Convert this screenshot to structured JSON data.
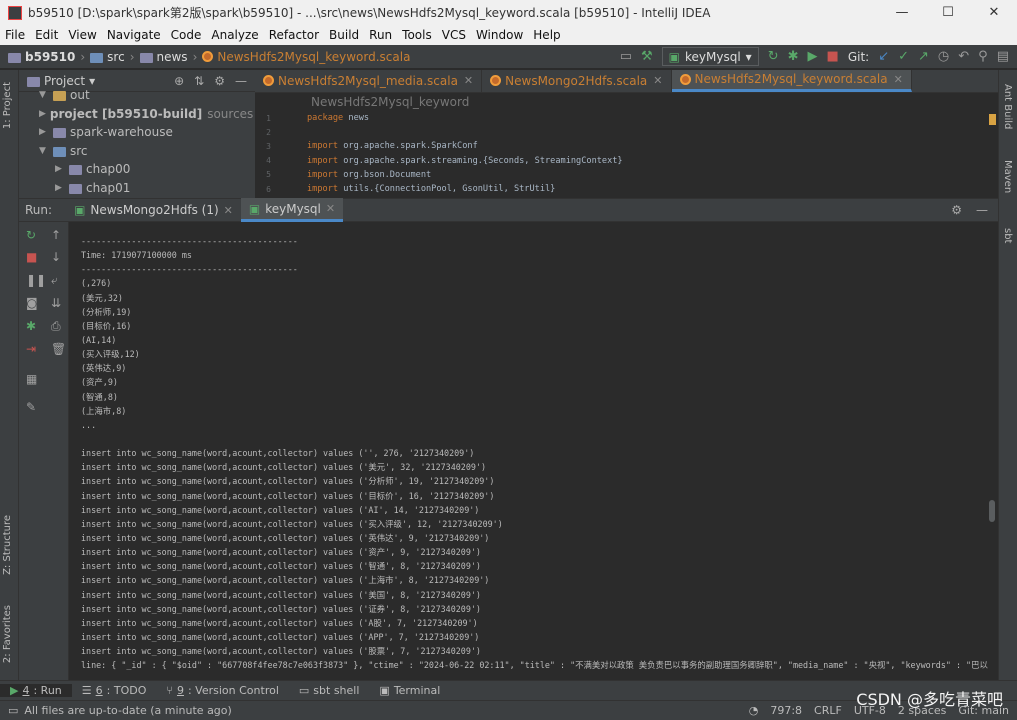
{
  "window": {
    "title": "b59510 [D:\\spark\\spark第2版\\spark\\b59510] - ...\\src\\news\\NewsHdfs2Mysql_keyword.scala [b59510] - IntelliJ IDEA",
    "controls": [
      "—",
      "☐",
      "✕"
    ]
  },
  "menu": [
    "File",
    "Edit",
    "View",
    "Navigate",
    "Code",
    "Analyze",
    "Refactor",
    "Build",
    "Run",
    "Tools",
    "VCS",
    "Window",
    "Help"
  ],
  "breadcrumb": {
    "project": "b59510",
    "src": "src",
    "pkg": "news",
    "file": "NewsHdfs2Mysql_keyword.scala"
  },
  "toolbar": {
    "run_config": "keyMysql",
    "git_label": "Git:"
  },
  "left_strip": {
    "project_tab": "1: Project",
    "structure_tab": "Z: Structure",
    "favorites_tab": "2: Favorites"
  },
  "right_strip": {
    "ant": "Ant Build",
    "maven": "Maven",
    "sbt": "sbt"
  },
  "project_panel": {
    "title": "Project",
    "items": [
      {
        "label": "out",
        "indent": 1,
        "expanded": true
      },
      {
        "label": "project [b59510-build]",
        "extra": "sources roo",
        "indent": 1,
        "expanded": false
      },
      {
        "label": "spark-warehouse",
        "indent": 1,
        "expanded": false
      },
      {
        "label": "src",
        "indent": 1,
        "expanded": true
      },
      {
        "label": "chap00",
        "indent": 2,
        "expanded": false
      },
      {
        "label": "chap01",
        "indent": 2,
        "expanded": false
      }
    ]
  },
  "editor": {
    "tabs": [
      {
        "label": "NewsHdfs2Mysql_media.scala",
        "active": false
      },
      {
        "label": "NewsMongo2Hdfs.scala",
        "active": false
      },
      {
        "label": "NewsHdfs2Mysql_keyword.scala",
        "active": true
      }
    ],
    "file_header": "NewsHdfs2Mysql_keyword",
    "lines": [
      {
        "n": "1",
        "kw": "package",
        "rest": " news"
      },
      {
        "n": "2",
        "kw": "",
        "rest": ""
      },
      {
        "n": "3",
        "kw": "import",
        "rest": " org.apache.spark.SparkConf"
      },
      {
        "n": "4",
        "kw": "import",
        "rest": " org.apache.spark.streaming.{Seconds, StreamingContext}"
      },
      {
        "n": "5",
        "kw": "import",
        "rest": " org.bson.Document"
      },
      {
        "n": "6",
        "kw": "import",
        "rest": " utils.{ConnectionPool, GsonUtil, StrUtil}"
      }
    ]
  },
  "run_panel": {
    "label": "Run:",
    "tabs": [
      {
        "label": "NewsMongo2Hdfs (1)",
        "active": false
      },
      {
        "label": "keyMysql",
        "active": true
      }
    ]
  },
  "console": [
    "-------------------------------------------",
    "Time: 1719077100000 ms",
    "-------------------------------------------",
    "(,276)",
    "(美元,32)",
    "(分析师,19)",
    "(目标价,16)",
    "(AI,14)",
    "(买入评级,12)",
    "(英伟达,9)",
    "(资产,9)",
    "(智通,8)",
    "(上海市,8)",
    "...",
    "",
    "insert into wc_song_name(word,acount,collector) values ('', 276, '2127340209')",
    "insert into wc_song_name(word,acount,collector) values ('美元', 32, '2127340209')",
    "insert into wc_song_name(word,acount,collector) values ('分析师', 19, '2127340209')",
    "insert into wc_song_name(word,acount,collector) values ('目标价', 16, '2127340209')",
    "insert into wc_song_name(word,acount,collector) values ('AI', 14, '2127340209')",
    "insert into wc_song_name(word,acount,collector) values ('买入评级', 12, '2127340209')",
    "insert into wc_song_name(word,acount,collector) values ('英伟达', 9, '2127340209')",
    "insert into wc_song_name(word,acount,collector) values ('资产', 9, '2127340209')",
    "insert into wc_song_name(word,acount,collector) values ('智通', 8, '2127340209')",
    "insert into wc_song_name(word,acount,collector) values ('上海市', 8, '2127340209')",
    "insert into wc_song_name(word,acount,collector) values ('美国', 8, '2127340209')",
    "insert into wc_song_name(word,acount,collector) values ('证券', 8, '2127340209')",
    "insert into wc_song_name(word,acount,collector) values ('A股', 7, '2127340209')",
    "insert into wc_song_name(word,acount,collector) values ('APP', 7, '2127340209')",
    "insert into wc_song_name(word,acount,collector) values ('股票', 7, '2127340209')",
    "line: { \"_id\" : { \"$oid\" : \"667708f4fee78c7e063f3873\" }, \"ctime\" : \"2024-06-22 02:11\", \"title\" : \"不满美对以政策 美负责巴以事务的副助理国务卿辞职\", \"media_name\" : \"央视\", \"keywords\" : \"巴以"
  ],
  "bottom_tabs": [
    {
      "num": "4",
      "label": ": Run",
      "active": true
    },
    {
      "num": "6",
      "label": ": TODO",
      "active": false
    },
    {
      "num": "9",
      "label": ": Version Control",
      "active": false
    },
    {
      "num": "",
      "label": "sbt shell",
      "active": false
    },
    {
      "num": "",
      "label": "Terminal",
      "active": false
    }
  ],
  "status": {
    "message": "All files are up-to-date (a minute ago)",
    "position": "797:8",
    "line_sep": "CRLF",
    "encoding": "UTF-8",
    "indent": "2 spaces",
    "git": "Git: main"
  },
  "watermark": "CSDN @多吃青菜吧"
}
